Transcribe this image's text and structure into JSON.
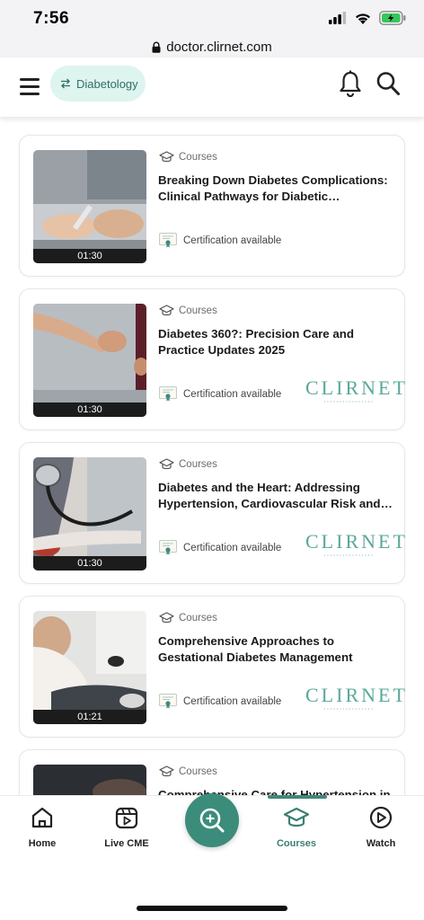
{
  "status_bar": {
    "time": "7:56"
  },
  "browser": {
    "url": "doctor.clirnet.com"
  },
  "header": {
    "specialty": "Diabetology"
  },
  "courses": [
    {
      "category": "Courses",
      "title": "Breaking Down Diabetes Complications: Clinical Pathways for Diabetic Retinopathy...",
      "duration": "01:30",
      "certification": "Certification available",
      "brand": ""
    },
    {
      "category": "Courses",
      "title": "Diabetes 360?: Precision Care and Practice Updates 2025",
      "duration": "01:30",
      "certification": "Certification available",
      "brand": "CLIRNET"
    },
    {
      "category": "Courses",
      "title": "Diabetes and the Heart: Addressing Hypertension, Cardiovascular Risk and He...",
      "duration": "01:30",
      "certification": "Certification available",
      "brand": "CLIRNET"
    },
    {
      "category": "Courses",
      "title": "Comprehensive Approaches to Gestational Diabetes Management",
      "duration": "01:21",
      "certification": "Certification available",
      "brand": "CLIRNET"
    },
    {
      "category": "Courses",
      "title": "Comprehensive Care for Hypertension in",
      "duration": "",
      "certification": "",
      "brand": ""
    }
  ],
  "bottom_nav": {
    "home": "Home",
    "live_cme": "Live CME",
    "courses": "Courses",
    "watch": "Watch",
    "active": "Courses"
  },
  "colors": {
    "accent": "#3b8c7b",
    "chip_bg": "#def4ef",
    "brand": "#5aa89a"
  },
  "icons": [
    "lock-icon",
    "swap-icon",
    "bell-icon",
    "search-icon",
    "graduation-cap-icon",
    "certificate-icon",
    "home-icon",
    "live-cme-icon",
    "discover-icon",
    "watch-icon"
  ]
}
